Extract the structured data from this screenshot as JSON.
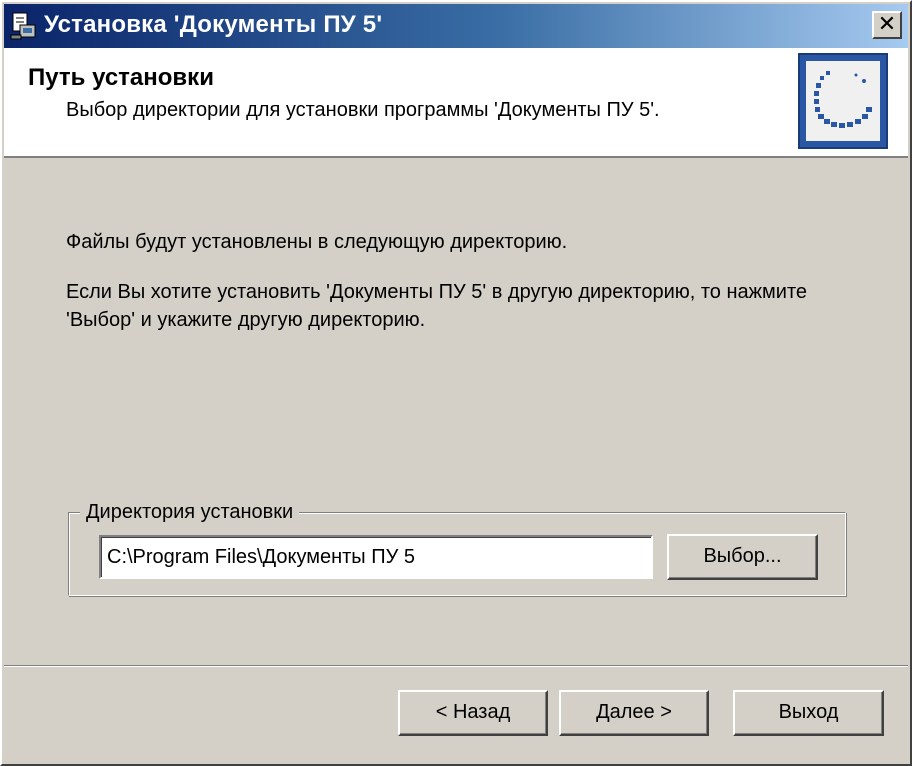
{
  "window": {
    "title": "Установка 'Документы ПУ 5'",
    "close_glyph": "✕",
    "icon": "setup-icon"
  },
  "header": {
    "title": "Путь установки",
    "subtitle": "Выбор директории для установки программы 'Документы ПУ 5'.",
    "logo": "product-logo"
  },
  "body": {
    "line1": "Файлы будут установлены в следующую директорию.",
    "line2": "Если Вы хотите установить 'Документы ПУ 5' в другую директорию, то нажмите 'Выбор' и укажите другую директорию."
  },
  "directory_group": {
    "label": "Директория установки",
    "path_value": "C:\\Program Files\\Документы ПУ 5",
    "browse_label": "Выбор..."
  },
  "footer": {
    "back_label": "< Назад",
    "next_label": "Далее >",
    "exit_label": "Выход"
  },
  "colors": {
    "titlebar_start": "#0a246a",
    "titlebar_end": "#a6caf0",
    "face": "#d4d0c8",
    "logo_blue": "#2a57a4"
  }
}
